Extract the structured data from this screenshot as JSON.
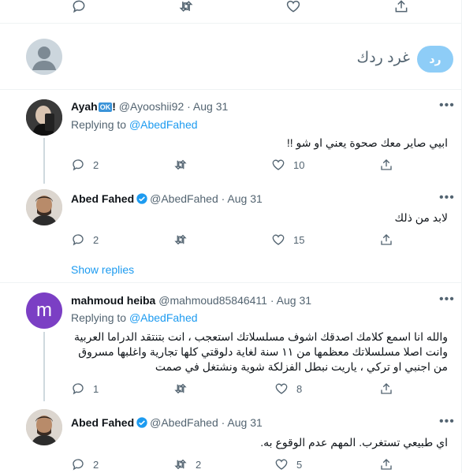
{
  "composer": {
    "placeholder": "غرد ردك",
    "reply_button": "رد"
  },
  "tweets": [
    {
      "name": "Ayah",
      "badge": "OK",
      "after_badge": "!",
      "handle": "@Ayooshii92",
      "date": "Aug 31",
      "replying_prefix": "Replying to",
      "replying_to": "@AbedFahed",
      "text": "ابيي صاير معك صحوة يعني او شو !!",
      "replies": "2",
      "retweets": "",
      "likes": "10"
    },
    {
      "name": "Abed Fahed",
      "handle": "@AbedFahed",
      "date": "Aug 31",
      "text": "لابد من ذلك",
      "replies": "2",
      "retweets": "",
      "likes": "15",
      "show_replies": "Show replies"
    },
    {
      "name": "mahmoud heiba",
      "handle": "@mahmoud85846411",
      "date": "Aug 31",
      "avatar_letter": "m",
      "replying_prefix": "Replying to",
      "replying_to": "@AbedFahed",
      "text": "والله انا اسمع كلامك اصدقك اشوف مسلسلاتك استعجب ، انت بتنتقد الدراما العربية وانت اصلا مسلسلاتك معظمها من ١١ سنة لغاية دلوقتي كلها تجارية واغلبها مسروق من اجنبي او تركي ، ياريت نبطل الفزلكة شوية ونشتغل في صمت",
      "replies": "1",
      "retweets": "",
      "likes": "8"
    },
    {
      "name": "Abed Fahed",
      "handle": "@AbedFahed",
      "date": "Aug 31",
      "text": "اي طبيعي تستغرب. المهم عدم الوقوع به.",
      "replies": "2",
      "retweets": "2",
      "likes": "5"
    }
  ],
  "colors": {
    "accent": "#1d9bf0",
    "reply_button_disabled": "#8ecdf7",
    "secondary_text": "#536471",
    "verified": "#1d9bf0",
    "mahmoud_avatar": "#7b3fc4"
  }
}
